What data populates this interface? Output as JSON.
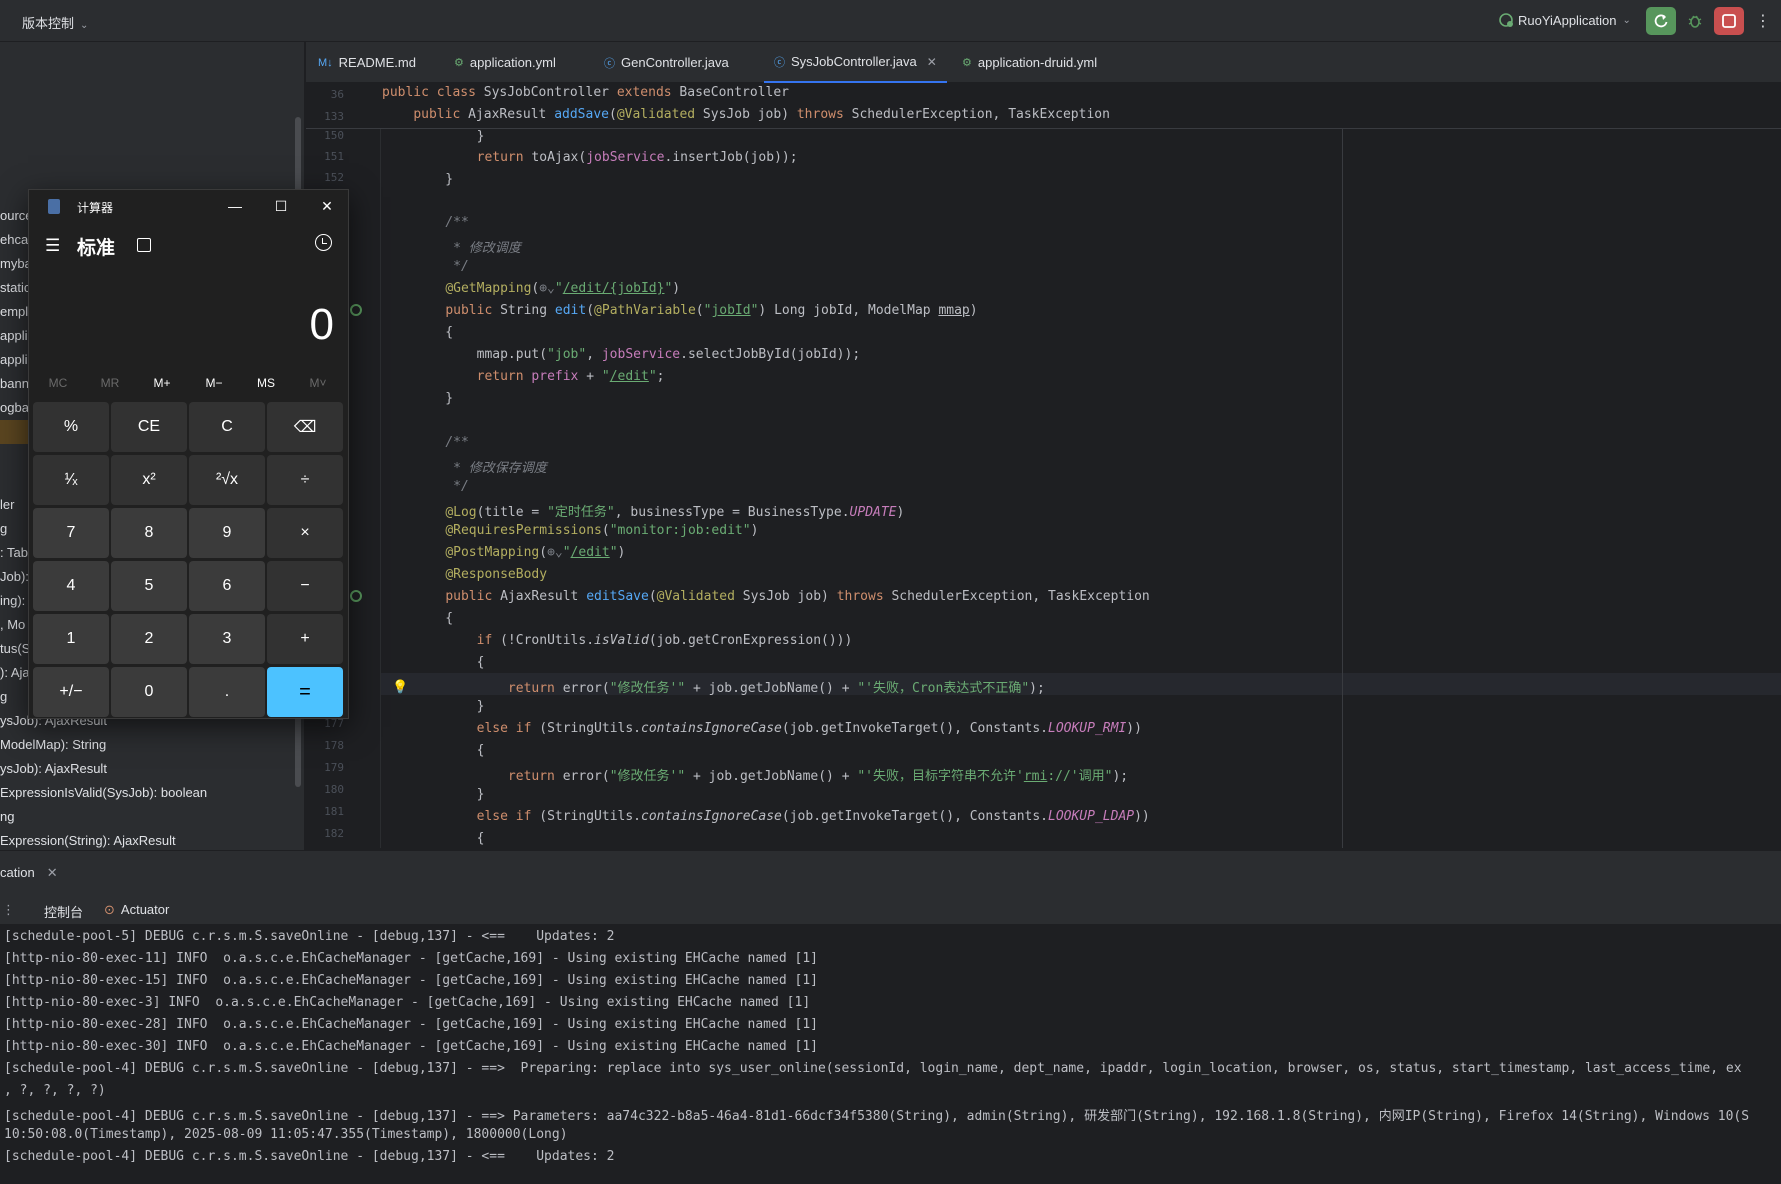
{
  "titlebar": {
    "vcs_label": "版本控制",
    "run_config": "RuoYiApplication"
  },
  "colors": {
    "accent": "#3574f0",
    "run_green": "#57965c",
    "stop_red": "#c94f4f",
    "calc_equals": "#4cc2ff"
  },
  "left_panel": {
    "items": [
      "ource",
      "ehcac",
      "myba",
      "static",
      "empl",
      "applic",
      "applic",
      "banne",
      "ogba",
      "ler",
      "g",
      ": Tab",
      "Job):",
      "ing):",
      ", Mo",
      "tus(Sy",
      "): Aja",
      "g",
      "ysJob): AjaxResult",
      "ModelMap): String",
      "ysJob): AjaxResult",
      "ExpressionIsValid(SysJob): boolean",
      "ng",
      "Expression(String): AjaxResult"
    ]
  },
  "tabs": [
    {
      "label": "README.md",
      "icon": "markdown-icon"
    },
    {
      "label": "application.yml",
      "icon": "yaml-icon"
    },
    {
      "label": "GenController.java",
      "icon": "java-class-icon"
    },
    {
      "label": "SysJobController.java",
      "icon": "java-class-icon",
      "active": true
    },
    {
      "label": "application-druid.yml",
      "icon": "yaml-icon"
    }
  ],
  "editor": {
    "sticky": [
      {
        "ln": "36",
        "text": "public class SysJobController extends BaseController"
      },
      {
        "ln": "133",
        "text": "    public AjaxResult addSave(@Validated SysJob job) throws SchedulerException, TaskException"
      }
    ],
    "line_numbers": [
      "150",
      "151",
      "152",
      "",
      "",
      "",
      "",
      "",
      "",
      "",
      "",
      "",
      "",
      "",
      "",
      "",
      "",
      "",
      "",
      "",
      "",
      "",
      "",
      "",
      "",
      "",
      "177",
      "178",
      "179",
      "180",
      "181",
      "182"
    ]
  },
  "calculator": {
    "title": "计算器",
    "mode": "标准",
    "display": "0",
    "memory": [
      "MC",
      "MR",
      "M+",
      "M−",
      "MS",
      "M˅"
    ],
    "keys": [
      "%",
      "CE",
      "C",
      "⌫",
      "¹⁄ₓ",
      "x²",
      "²√x",
      "÷",
      "7",
      "8",
      "9",
      "×",
      "4",
      "5",
      "6",
      "−",
      "1",
      "2",
      "3",
      "+",
      "+/−",
      "0",
      ".",
      "="
    ]
  },
  "run_panel": {
    "title": "cation",
    "tabs": [
      "控制台",
      "Actuator"
    ]
  },
  "console": [
    "[schedule-pool-5] DEBUG c.r.s.m.S.saveOnline - [debug,137] - <==    Updates: 2",
    "[http-nio-80-exec-11] INFO  o.a.s.c.e.EhCacheManager - [getCache,169] - Using existing EHCache named [1]",
    "[http-nio-80-exec-15] INFO  o.a.s.c.e.EhCacheManager - [getCache,169] - Using existing EHCache named [1]",
    "[http-nio-80-exec-3] INFO  o.a.s.c.e.EhCacheManager - [getCache,169] - Using existing EHCache named [1]",
    "[http-nio-80-exec-28] INFO  o.a.s.c.e.EhCacheManager - [getCache,169] - Using existing EHCache named [1]",
    "[http-nio-80-exec-30] INFO  o.a.s.c.e.EhCacheManager - [getCache,169] - Using existing EHCache named [1]",
    "[schedule-pool-4] DEBUG c.r.s.m.S.saveOnline - [debug,137] - ==>  Preparing: replace into sys_user_online(sessionId, login_name, dept_name, ipaddr, login_location, browser, os, status, start_timestamp, last_access_time, ex",
    ", ?, ?, ?, ?)",
    "[schedule-pool-4] DEBUG c.r.s.m.S.saveOnline - [debug,137] - ==> Parameters: aa74c322-b8a5-46a4-81d1-66dcf34f5380(String), admin(String), 研发部门(String), 192.168.1.8(String), 内网IP(String), Firefox 14(String), Windows 10(S",
    "10:50:08.0(Timestamp), 2025-08-09 11:05:47.355(Timestamp), 1800000(Long)",
    "[schedule-pool-4] DEBUG c.r.s.m.S.saveOnline - [debug,137] - <==    Updates: 2"
  ]
}
